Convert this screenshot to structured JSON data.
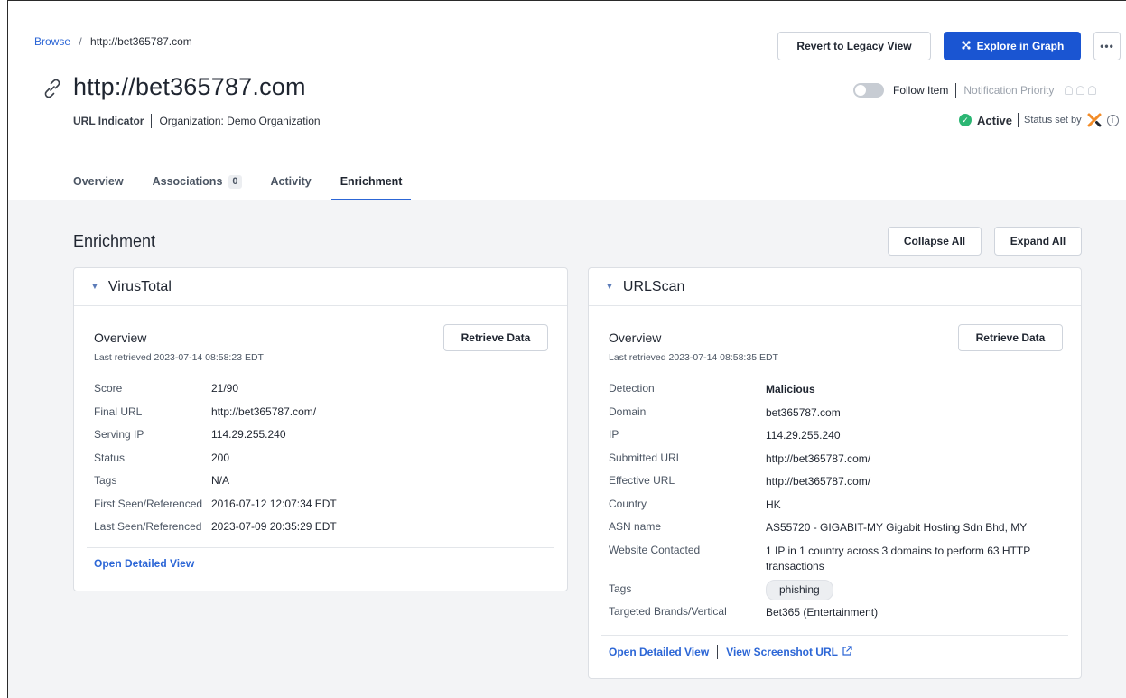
{
  "breadcrumb": {
    "root": "Browse",
    "separator": "/",
    "current": "http://bet365787.com"
  },
  "header": {
    "revert_label": "Revert to Legacy View",
    "graph_label": "Explore in Graph",
    "more_label": "•••",
    "title": "http://bet365787.com",
    "type": "URL Indicator",
    "organization": "Organization: Demo Organization",
    "follow_label": "Follow Item",
    "notification_label": "Notification Priority",
    "status": "Active",
    "status_set_by": "Status set by"
  },
  "tabs": [
    {
      "label": "Overview"
    },
    {
      "label": "Associations",
      "count": "0"
    },
    {
      "label": "Activity"
    },
    {
      "label": "Enrichment",
      "active": true
    }
  ],
  "enrichment": {
    "title": "Enrichment",
    "collapse_label": "Collapse All",
    "expand_label": "Expand All"
  },
  "virustotal": {
    "name": "VirusTotal",
    "overview_title": "Overview",
    "last_retrieved": "Last retrieved 2023-07-14 08:58:23 EDT",
    "retrieve_label": "Retrieve Data",
    "rows": [
      {
        "k": "Score",
        "v": "21/90"
      },
      {
        "k": "Final URL",
        "v": "http://bet365787.com/"
      },
      {
        "k": "Serving IP",
        "v": "114.29.255.240"
      },
      {
        "k": "Status",
        "v": "200"
      },
      {
        "k": "Tags",
        "v": "N/A"
      },
      {
        "k": "First Seen/Referenced",
        "v": "2016-07-12 12:07:34 EDT"
      },
      {
        "k": "Last Seen/Referenced",
        "v": "2023-07-09 20:35:29 EDT"
      }
    ],
    "detail_link": "Open Detailed View"
  },
  "urlscan": {
    "name": "URLScan",
    "overview_title": "Overview",
    "last_retrieved": "Last retrieved 2023-07-14 08:58:35 EDT",
    "retrieve_label": "Retrieve Data",
    "rows": {
      "detection_k": "Detection",
      "detection_v": "Malicious",
      "domain_k": "Domain",
      "domain_v": "bet365787.com",
      "ip_k": "IP",
      "ip_v": "114.29.255.240",
      "submitted_k": "Submitted URL",
      "submitted_v": "http://bet365787.com/",
      "effective_k": "Effective URL",
      "effective_v": "http://bet365787.com/",
      "country_k": "Country",
      "country_v": "HK",
      "asn_k": "ASN name",
      "asn_v": "AS55720 - GIGABIT-MY Gigabit Hosting Sdn Bhd, MY",
      "contacted_k": "Website Contacted",
      "contacted_v": "1 IP in 1 country across 3 domains to perform 63 HTTP transactions",
      "tags_k": "Tags",
      "tags_v": "phishing",
      "brands_k": "Targeted Brands/Vertical",
      "brands_v": "Bet365 (Entertainment)"
    },
    "detail_link": "Open Detailed View",
    "screenshot_link": "View Screenshot URL"
  },
  "colors": {
    "accent": "#1a55d2",
    "link": "#2c66d6",
    "malicious": "#8b1a1a",
    "active": "#2bb673",
    "logo": "#f28c28"
  }
}
